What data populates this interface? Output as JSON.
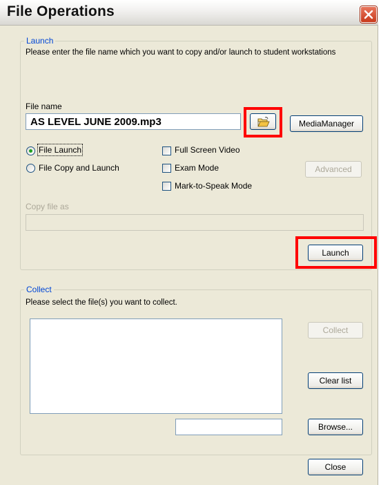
{
  "window": {
    "title": "File Operations"
  },
  "launch": {
    "legend": "Launch",
    "instruction": "Please enter the file name which you want to copy and/or launch to student workstations",
    "file_name_label": "File name",
    "file_name_value": "AS LEVEL JUNE 2009.mp3",
    "browse_folder_icon": "open-folder-icon",
    "media_manager_label": "MediaManager",
    "radio_file_launch": "File Launch",
    "radio_file_copy_launch": "File Copy and Launch",
    "check_full_screen": "Full Screen Video",
    "check_exam_mode": "Exam Mode",
    "check_mark_to_speak": "Mark-to-Speak Mode",
    "advanced_label": "Advanced",
    "copy_file_as_label": "Copy file as",
    "copy_file_as_value": "",
    "launch_label": "Launch",
    "selected_mode": "File Launch"
  },
  "collect": {
    "legend": "Collect",
    "instruction": "Please select the file(s) you want to collect.",
    "collect_label": "Collect",
    "clear_list_label": "Clear list",
    "browse_label": "Browse...",
    "path_value": ""
  },
  "close_label": "Close",
  "colors": {
    "dialog_bg": "#ece9d8",
    "legend_blue": "#0046d5",
    "highlight_red": "#ff0000",
    "close_red": "#c8391a"
  }
}
